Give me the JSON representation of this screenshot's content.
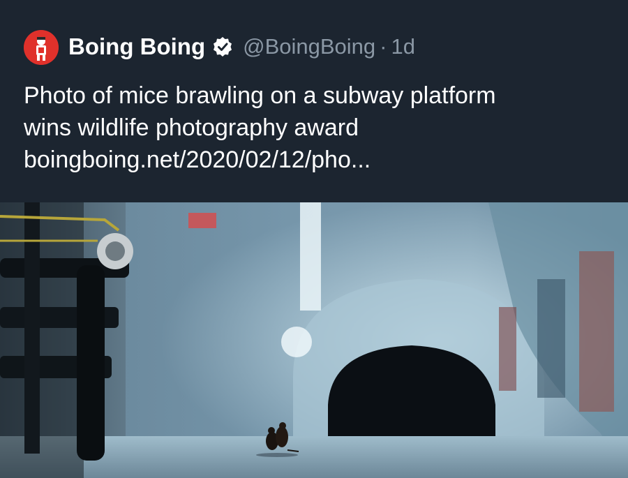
{
  "tweet": {
    "display_name": "Boing Boing",
    "handle": "@BoingBoing",
    "separator": "·",
    "time_ago": "1d",
    "text_lines": [
      "Photo of mice brawling on a subway platform",
      "wins wildlife photography award",
      "boingboing.net/2020/02/12/pho..."
    ]
  },
  "icons": {
    "avatar": "boing-boing-avatar-icon",
    "verified": "verified-badge-icon"
  },
  "colors": {
    "background": "#15202b",
    "header_background": "#1c2530",
    "text_primary": "#ffffff",
    "text_secondary": "#8b98a5",
    "avatar_red": "#e0312b"
  }
}
